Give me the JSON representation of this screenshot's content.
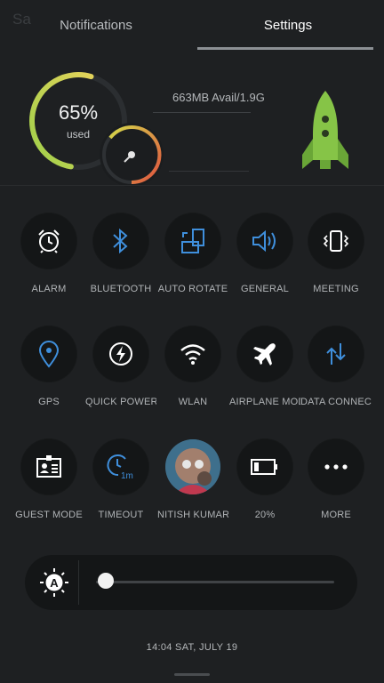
{
  "background_hint": "Sa",
  "tabs": [
    {
      "label": "Notifications",
      "active": false
    },
    {
      "label": "Settings",
      "active": true
    }
  ],
  "memory": {
    "percent_text": "65%",
    "percent_value": 0.65,
    "used_label": "used",
    "avail_text": "663MB Avail/1.9G",
    "colors": {
      "ring_start": "#c7e05a",
      "ring_end": "#e3d35a",
      "small_ring_end": "#e0523f",
      "rocket": "#86c447"
    }
  },
  "toggles": [
    {
      "label": "ALARM",
      "icon": "alarm-icon",
      "color": "#ffffff"
    },
    {
      "label": "BLUETOOTH",
      "icon": "bluetooth-icon",
      "color": "#3f8fdc"
    },
    {
      "label": "AUTO ROTATE",
      "icon": "auto-rotate-icon",
      "color": "#3f8fdc"
    },
    {
      "label": "GENERAL",
      "icon": "volume-icon",
      "color": "#3f8fdc"
    },
    {
      "label": "MEETING",
      "icon": "vibrate-icon",
      "color": "#ffffff"
    },
    {
      "label": "GPS",
      "icon": "location-pin-icon",
      "color": "#3f8fdc"
    },
    {
      "label": "QUICK POWER",
      "icon": "power-bolt-icon",
      "color": "#ffffff"
    },
    {
      "label": "WLAN",
      "icon": "wifi-icon",
      "color": "#ffffff"
    },
    {
      "label": "AIRPLANE MODE",
      "icon": "airplane-icon",
      "color": "#ffffff"
    },
    {
      "label": "DATA CONNECTION",
      "icon": "data-arrows-icon",
      "color": "#3f8fdc"
    },
    {
      "label": "GUEST MODE",
      "icon": "guest-badge-icon",
      "color": "#ffffff"
    },
    {
      "label": "TIMEOUT",
      "icon": "timeout-clock-icon",
      "color": "#3f8fdc",
      "badge": "1m"
    },
    {
      "label": "NITISH KUMAR",
      "icon": "user-avatar",
      "color": "#ffffff"
    },
    {
      "label": "20%",
      "icon": "battery-icon",
      "color": "#ffffff"
    },
    {
      "label": "MORE",
      "icon": "more-dots-icon",
      "color": "#ffffff"
    }
  ],
  "brightness": {
    "icon": "auto-brightness-icon",
    "level": 0.02,
    "auto_letter": "A"
  },
  "footer": {
    "datetime": "14:04  SAT, JULY 19"
  }
}
